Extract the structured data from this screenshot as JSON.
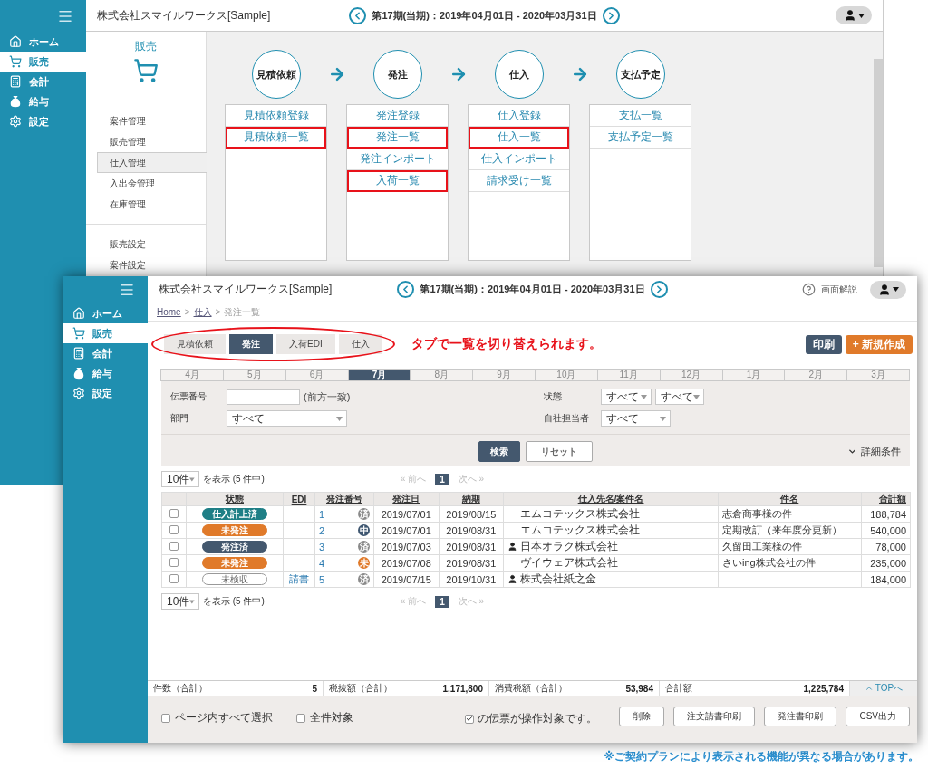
{
  "back_window": {
    "company": "株式会社スマイルワークス[Sample]",
    "period": "第17期(当期)：2019年04月01日 - 2020年03月31日",
    "sidebar": [
      {
        "label": "ホーム",
        "selected": false
      },
      {
        "label": "販売",
        "selected": true
      },
      {
        "label": "会計",
        "selected": false
      },
      {
        "label": "給与",
        "selected": false
      },
      {
        "label": "設定",
        "selected": false
      }
    ],
    "submenu": {
      "title": "販売",
      "items": [
        {
          "label": "案件管理",
          "selected": false
        },
        {
          "label": "販売管理",
          "selected": false
        },
        {
          "label": "仕入管理",
          "selected": true
        },
        {
          "label": "入出金管理",
          "selected": false
        },
        {
          "label": "在庫管理",
          "selected": false
        }
      ],
      "settings": [
        "販売設定",
        "案件設定"
      ]
    },
    "flow": [
      {
        "step": "見積依頼",
        "links": [
          {
            "label": "見積依頼登録",
            "highlighted": false
          },
          {
            "label": "見積依頼一覧",
            "highlighted": true
          }
        ]
      },
      {
        "step": "発注",
        "links": [
          {
            "label": "発注登録",
            "highlighted": false
          },
          {
            "label": "発注一覧",
            "highlighted": true
          },
          {
            "label": "発注インポート",
            "highlighted": false
          },
          {
            "label": "入荷一覧",
            "highlighted": true
          }
        ]
      },
      {
        "step": "仕入",
        "links": [
          {
            "label": "仕入登録",
            "highlighted": false
          },
          {
            "label": "仕入一覧",
            "highlighted": true
          },
          {
            "label": "仕入インポート",
            "highlighted": false
          },
          {
            "label": "請求受け一覧",
            "highlighted": false
          }
        ]
      },
      {
        "step": "支払予定",
        "links": [
          {
            "label": "支払一覧",
            "highlighted": false
          },
          {
            "label": "支払予定一覧",
            "highlighted": false
          }
        ]
      }
    ]
  },
  "front_window": {
    "company": "株式会社スマイルワークス[Sample]",
    "period": "第17期(当期)：2019年04月01日 - 2020年03月31日",
    "help": "画面解説",
    "sidebar": [
      {
        "label": "ホーム",
        "selected": false
      },
      {
        "label": "販売",
        "selected": true
      },
      {
        "label": "会計",
        "selected": false
      },
      {
        "label": "給与",
        "selected": false
      },
      {
        "label": "設定",
        "selected": false
      }
    ],
    "breadcrumb": [
      {
        "text": "Home",
        "kind": "link"
      },
      {
        "text": ">",
        "kind": "separator"
      },
      {
        "text": "仕入",
        "kind": "link"
      },
      {
        "text": ">",
        "kind": "separator"
      },
      {
        "text": "発注一覧",
        "kind": "current"
      }
    ],
    "tabs": [
      {
        "label": "見積依頼",
        "selected": false
      },
      {
        "label": "発注",
        "selected": true
      },
      {
        "label": "入荷EDI",
        "selected": false
      },
      {
        "label": "仕入",
        "selected": false
      }
    ],
    "callout": "タブで一覧を切り替えられます。",
    "actions": [
      {
        "label": "印刷",
        "kind": "dark"
      },
      {
        "label": "+ 新規作成",
        "kind": "orange"
      }
    ],
    "months": [
      {
        "label": "4月",
        "selected": false
      },
      {
        "label": "5月",
        "selected": false
      },
      {
        "label": "6月",
        "selected": false
      },
      {
        "label": "7月",
        "selected": true
      },
      {
        "label": "8月",
        "selected": false
      },
      {
        "label": "9月",
        "selected": false
      },
      {
        "label": "10月",
        "selected": false
      },
      {
        "label": "11月",
        "selected": false
      },
      {
        "label": "12月",
        "selected": false
      },
      {
        "label": "1月",
        "selected": false
      },
      {
        "label": "2月",
        "selected": false
      },
      {
        "label": "3月",
        "selected": false
      }
    ],
    "filters": {
      "slip_no": {
        "label": "伝票番号",
        "hint": "(前方一致)"
      },
      "department": {
        "label": "部門",
        "value": "すべて"
      },
      "status": {
        "label": "状態",
        "values": [
          "すべて",
          "すべて"
        ]
      },
      "staff": {
        "label": "自社担当者",
        "value": "すべて"
      }
    },
    "search_buttons": [
      {
        "label": "検索",
        "kind": "primary"
      },
      {
        "label": "リセット",
        "kind": "secondary"
      }
    ],
    "details": "詳細条件",
    "pagers": [
      {
        "per_page": "10件",
        "summary": "を表示 (5 件中)",
        "prev": "« 前へ",
        "page": "1",
        "next": "次へ »"
      },
      {
        "per_page": "10件",
        "summary": "を表示 (5 件中)",
        "prev": "« 前へ",
        "page": "1",
        "next": "次へ »"
      }
    ],
    "table": {
      "columns": [
        "状態",
        "EDI",
        "発注番号",
        "発注日",
        "納期",
        "仕入先名/案件名",
        "件名",
        "合計額"
      ],
      "rows": [
        {
          "checked": false,
          "status": {
            "label": "仕入計上済",
            "kind": "filled",
            "color": "#1f7f86"
          },
          "number": "1",
          "mark": {
            "label": "済",
            "color": "#8a8a8a"
          },
          "ordered": "2019/07/01",
          "due": "2019/08/15",
          "has_contact": false,
          "vendor": "エムコテックス株式会社",
          "subject": "志倉商事様の件",
          "total": "188,784"
        },
        {
          "checked": false,
          "status": {
            "label": "未発注",
            "kind": "filled",
            "color": "#e07a2a"
          },
          "number": "2",
          "mark": {
            "label": "中",
            "color": "#3e5670"
          },
          "ordered": "2019/07/01",
          "due": "2019/08/31",
          "has_contact": false,
          "vendor": "エムコテックス株式会社",
          "subject": "定期改訂（来年度分更新）",
          "total": "540,000"
        },
        {
          "checked": false,
          "status": {
            "label": "発注済",
            "kind": "filled",
            "color": "#44586e"
          },
          "number": "3",
          "mark": {
            "label": "済",
            "color": "#8a8a8a"
          },
          "ordered": "2019/07/03",
          "due": "2019/08/31",
          "has_contact": true,
          "vendor": "日本オラク株式会社",
          "subject": "久留田工業様の件",
          "total": "78,000"
        },
        {
          "checked": false,
          "status": {
            "label": "未発注",
            "kind": "filled",
            "color": "#e07a2a"
          },
          "number": "4",
          "mark": {
            "label": "未",
            "color": "#e07a2a"
          },
          "ordered": "2019/07/08",
          "due": "2019/08/31",
          "has_contact": false,
          "vendor": "ヴイウェア株式会社",
          "subject": "さいing株式会社の件",
          "total": "235,000"
        },
        {
          "checked": false,
          "status": {
            "label": "未検収",
            "kind": "outline"
          },
          "edi": "請書",
          "number": "5",
          "mark": {
            "label": "済",
            "color": "#8a8a8a"
          },
          "ordered": "2019/07/15",
          "due": "2019/10/31",
          "has_contact": true,
          "vendor": "株式会社紙之金",
          "total": "184,000"
        }
      ]
    },
    "totals": [
      {
        "label": "件数（合計）",
        "value": "5"
      },
      {
        "label": "税抜額（合計）",
        "value": "1,171,800"
      },
      {
        "label": "消費税額（合計）",
        "value": "53,984"
      },
      {
        "label": "合計額",
        "value": "1,225,784"
      }
    ],
    "top_link": "TOPへ",
    "bulk": {
      "options": [
        {
          "label": "ページ内すべて選択",
          "checked": false
        },
        {
          "label": "全件対象",
          "checked": false
        }
      ],
      "target": {
        "label": "の伝票が操作対象です。",
        "checked": true
      },
      "buttons": [
        "削除",
        "注文請書印刷",
        "発注書印刷",
        "CSV出力"
      ]
    }
  },
  "footnote": "※ご契約プランにより表示される機能が異なる場合があります。"
}
